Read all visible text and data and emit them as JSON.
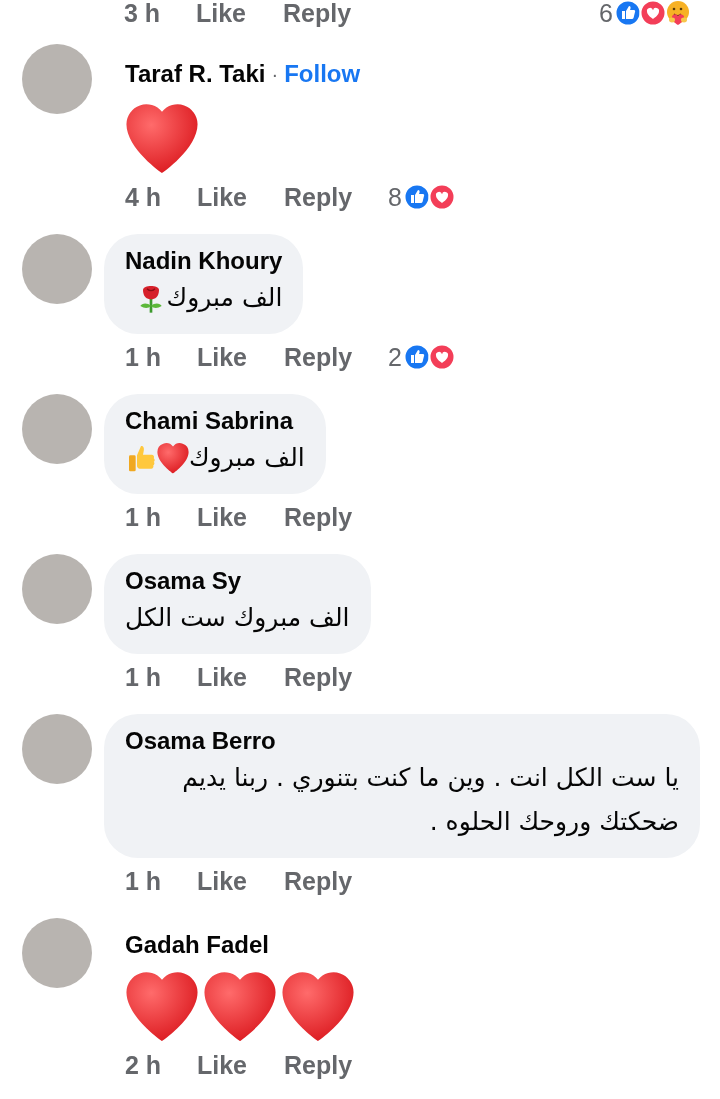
{
  "top_actions": {
    "time": "3 h",
    "like": "Like",
    "reply": "Reply",
    "reaction_count": "6",
    "reactions": [
      {
        "kind": "like"
      },
      {
        "kind": "love"
      },
      {
        "kind": "care"
      }
    ]
  },
  "comments": [
    {
      "kind": "emoji",
      "author": "Taraf R. Taki",
      "separator": "·",
      "follow": "Follow",
      "body": [
        {
          "kind": "heart"
        }
      ],
      "time": "4 h",
      "like": "Like",
      "reply": "Reply",
      "reaction_count": "8",
      "reactions": [
        {
          "kind": "like"
        },
        {
          "kind": "love"
        }
      ]
    },
    {
      "kind": "text",
      "author": "Nadin Khoury",
      "body": [
        {
          "kind": "text",
          "text": "الف مبروك"
        },
        {
          "kind": "rose"
        }
      ],
      "time": "1 h",
      "like": "Like",
      "reply": "Reply",
      "reaction_count": "2",
      "reactions": [
        {
          "kind": "like"
        },
        {
          "kind": "love"
        }
      ]
    },
    {
      "kind": "text",
      "author": "Chami Sabrina",
      "body": [
        {
          "kind": "text",
          "text": "الف مبروك"
        },
        {
          "kind": "heart"
        },
        {
          "kind": "thumbs"
        }
      ],
      "time": "1 h",
      "like": "Like",
      "reply": "Reply"
    },
    {
      "kind": "text",
      "author": "Osama Sy",
      "body": [
        {
          "kind": "text",
          "text": "الف مبروك ست الكل"
        }
      ],
      "time": "1 h",
      "like": "Like",
      "reply": "Reply"
    },
    {
      "kind": "text",
      "author": "Osama Berro",
      "body": [
        {
          "kind": "text",
          "text": "يا ست الكل انت . وين ما كنت بتنوري . ربنا يديم ضحكتك وروحك الحلوه ."
        }
      ],
      "time": "1 h",
      "like": "Like",
      "reply": "Reply"
    },
    {
      "kind": "emoji",
      "author": "Gadah Fadel",
      "body": [
        {
          "kind": "heart"
        },
        {
          "kind": "heart"
        },
        {
          "kind": "heart"
        }
      ],
      "time": "2 h",
      "like": "Like",
      "reply": "Reply"
    }
  ]
}
